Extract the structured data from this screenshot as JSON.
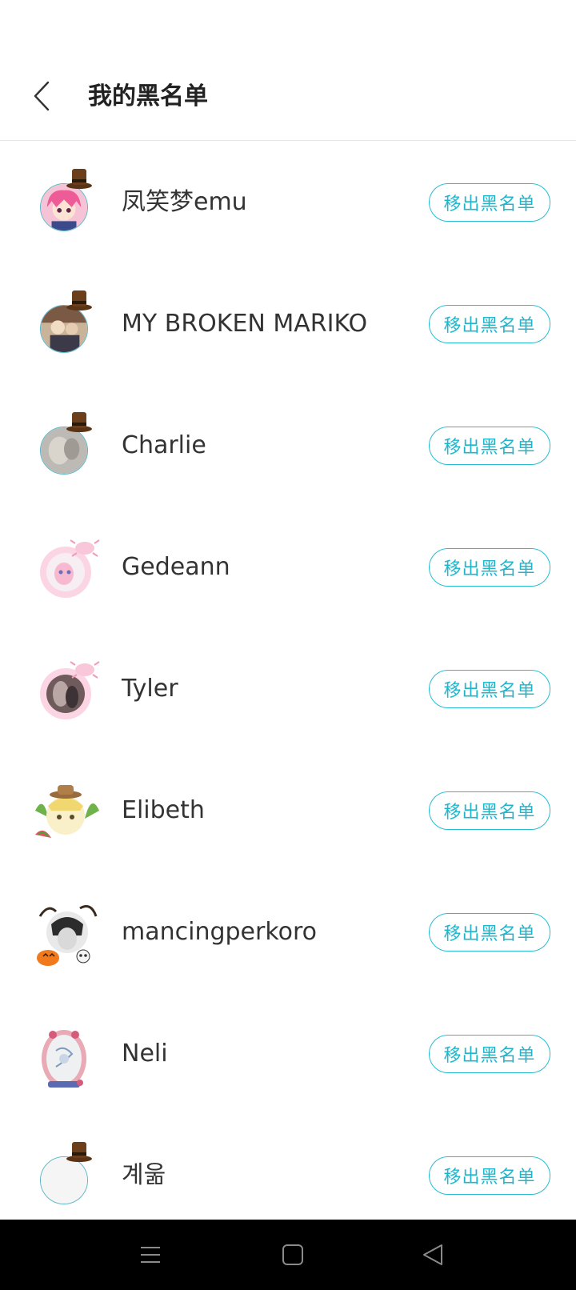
{
  "header": {
    "title": "我的黑名单"
  },
  "list": {
    "remove_label": "移出黑名单",
    "items": [
      {
        "name": "凤笑梦emu",
        "avatar": "pink-hair-girl-avatar",
        "decor": "hat"
      },
      {
        "name": "MY BROKEN MARIKO",
        "avatar": "illustration-avatar",
        "decor": "hat"
      },
      {
        "name": "Charlie",
        "avatar": "grey-portrait-avatar",
        "decor": "hat"
      },
      {
        "name": "Gedeann",
        "avatar": "axolotl-frame-avatar",
        "decor": "axolotl-frame"
      },
      {
        "name": "Tyler",
        "avatar": "axolotl-frame-avatar",
        "decor": "axolotl-frame"
      },
      {
        "name": "Elibeth",
        "avatar": "watermelon-frame-avatar",
        "decor": "leaf-frame"
      },
      {
        "name": "mancingperkoro",
        "avatar": "halloween-frame-avatar",
        "decor": "halloween-frame"
      },
      {
        "name": "Neli",
        "avatar": "ornate-frame-avatar",
        "decor": "ornate-frame"
      },
      {
        "name": "계욺",
        "avatar": "default-avatar",
        "decor": "hat"
      }
    ]
  },
  "colors": {
    "accent": "#20b6cc",
    "text": "#333333",
    "divider": "#e6e6e6",
    "navbar": "#000000"
  },
  "navbar": {
    "icons": [
      "menu-icon",
      "home-icon",
      "back-triangle-icon"
    ]
  }
}
